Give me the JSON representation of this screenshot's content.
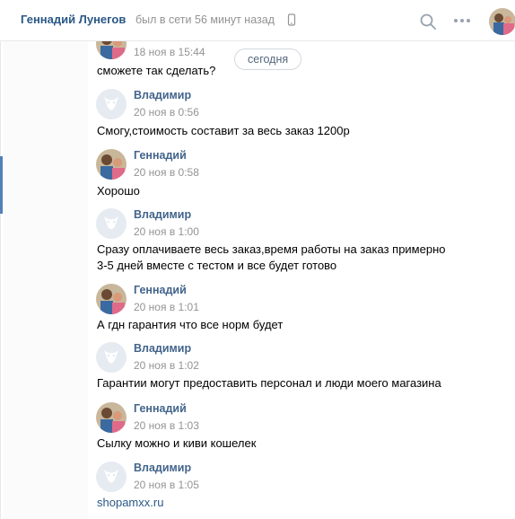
{
  "header": {
    "name": "Геннадий Лунегов",
    "status": "был в сети 56 минут назад"
  },
  "date_separator": "сегодня",
  "icons": {
    "phone": "phone-icon",
    "search": "search-icon",
    "more": "more-icon"
  },
  "colors": {
    "link": "#2a5885",
    "author": "#42648b",
    "muted": "#939393",
    "accent": "#5181b8"
  },
  "messages": [
    {
      "author": "",
      "time": "18 ноя в 15:44",
      "text": "сможете так сделать?"
    },
    {
      "author": "Владимир",
      "time": "20 ноя в 0:56",
      "text": "Смогу,стоимость составит за весь заказ 1200р"
    },
    {
      "author": "Геннадий",
      "time": "20 ноя в 0:58",
      "text": "Хорошо"
    },
    {
      "author": "Владимир",
      "time": "20 ноя в 1:00",
      "text": "Сразу оплачиваете весь заказ,время работы на заказ примерно",
      "text2": "3-5 дней вместе с тестом и все будет готово"
    },
    {
      "author": "Геннадий",
      "time": "20 ноя в 1:01",
      "text": "А гдн гарантия что все норм будет"
    },
    {
      "author": "Владимир",
      "time": "20 ноя в 1:02",
      "text": "Гарантии могут предоставить персонал и люди моего магазина"
    },
    {
      "author": "Геннадий",
      "time": "20 ноя в 1:03",
      "text": "Сылку можно и киви кошелек"
    },
    {
      "author": "Владимир",
      "time": "20 ноя в 1:05",
      "text": "shopamxx.ru"
    }
  ]
}
